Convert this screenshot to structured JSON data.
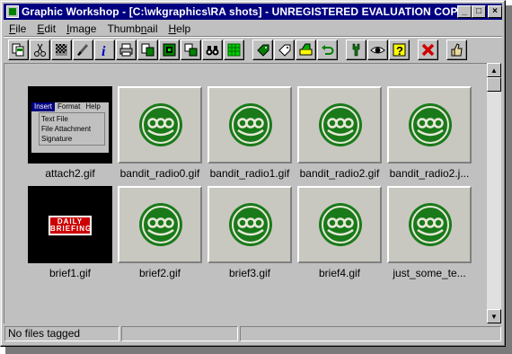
{
  "window": {
    "title": "Graphic Workshop - [C:\\wkgraphics\\RA shots] - UNREGISTERED EVALUATION COPY",
    "controls": {
      "minimize": "_",
      "maximize": "□",
      "close": "×"
    }
  },
  "menubar": {
    "items": [
      {
        "label": "File",
        "accel": "F",
        "rest": "ile"
      },
      {
        "label": "Edit",
        "accel": "E",
        "rest": "dit"
      },
      {
        "label": "Image",
        "accel": "I",
        "rest": "mage"
      },
      {
        "label": "Thumbnail",
        "pre": "Thumb",
        "accel": "n",
        "rest": "ail"
      },
      {
        "label": "Help",
        "accel": "H",
        "rest": "elp"
      }
    ]
  },
  "toolbar": {
    "buttons": [
      "copy-icon",
      "scissors-icon",
      "dither-icon",
      "brush-icon",
      "info-icon",
      "print-icon",
      "convert-icon",
      "effects-icon",
      "transform-icon",
      "binoculars-icon",
      "grid-icon",
      "tag-icon",
      "untag-icon",
      "scanner-icon",
      "undo-icon",
      "tools-icon",
      "eye-icon",
      "help-icon",
      "delete-icon",
      "thumbs-up-icon"
    ]
  },
  "thumbnails": [
    {
      "name": "attach2.gif",
      "kind": "menu-screenshot"
    },
    {
      "name": "bandit_radio0.gif",
      "kind": "logo"
    },
    {
      "name": "bandit_radio1.gif",
      "kind": "logo"
    },
    {
      "name": "bandit_radio2.gif",
      "kind": "logo"
    },
    {
      "name": "bandit_radio2.j...",
      "kind": "logo"
    },
    {
      "name": "brief1.gif",
      "kind": "daily-briefing"
    },
    {
      "name": "brief2.gif",
      "kind": "logo"
    },
    {
      "name": "brief3.gif",
      "kind": "logo"
    },
    {
      "name": "brief4.gif",
      "kind": "logo"
    },
    {
      "name": "just_some_te...",
      "kind": "logo"
    }
  ],
  "attach_preview": {
    "menu": [
      "Insert",
      "Format",
      "Help"
    ],
    "items": [
      "Text File",
      "File Attachment",
      "Signature"
    ]
  },
  "brief_preview": {
    "line1": "DAILY",
    "line2": "BRIEFING"
  },
  "statusbar": {
    "text": "No files tagged"
  },
  "colors": {
    "titlebar": "#000080",
    "logo_green": "#1a7a1a",
    "briefing_red": "#cc0000"
  }
}
